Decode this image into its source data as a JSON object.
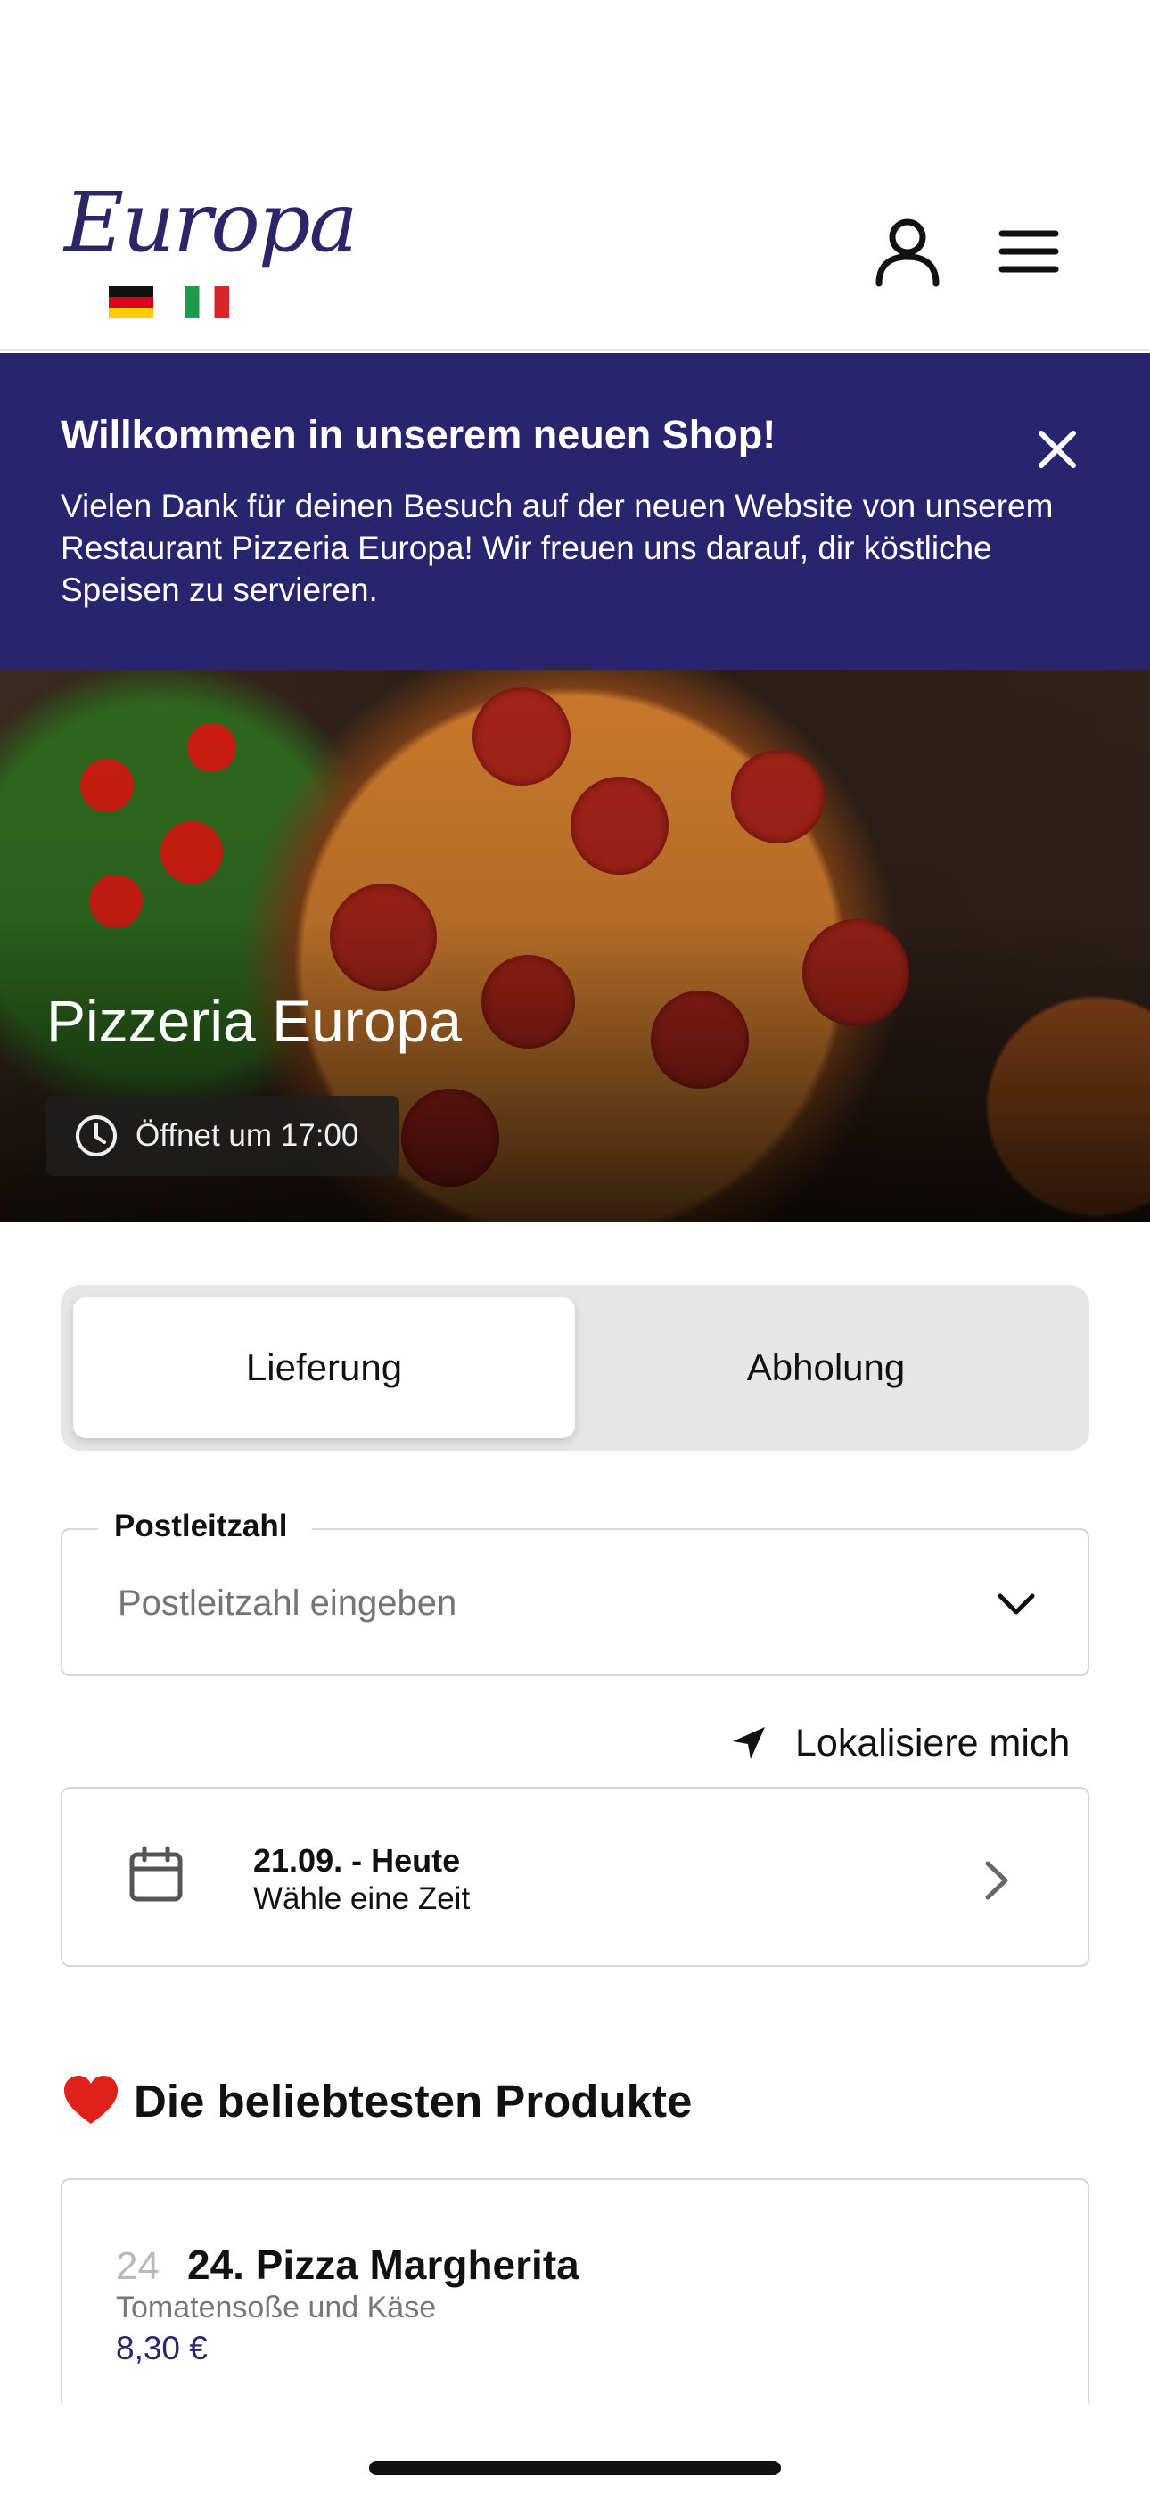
{
  "header": {
    "logo_text": "Europa",
    "languages": [
      {
        "code": "de",
        "icon": "german-flag-icon"
      },
      {
        "code": "it",
        "icon": "italian-flag-icon"
      }
    ],
    "user_icon": "user-icon",
    "menu_icon": "hamburger-menu-icon"
  },
  "banner": {
    "title": "Willkommen in unserem neuen Shop!",
    "text": "Vielen Dank für deinen Besuch auf der neuen Website von unserem Restaurant Pizzeria Europa! Wir freuen uns darauf, dir köstliche Speisen zu servieren.",
    "background": "#29246e",
    "close_icon": "close-icon"
  },
  "hero": {
    "restaurant_name": "Pizzeria Europa",
    "status": "Öffnet um 17:00",
    "status_icon": "clock-icon"
  },
  "order_mode": {
    "options": [
      "Lieferung",
      "Abholung"
    ],
    "selected": "Lieferung"
  },
  "postal_code": {
    "label": "Postleitzahl",
    "placeholder": "Postleitzahl eingeben",
    "value": ""
  },
  "locate": {
    "label": "Lokalisiere mich",
    "icon": "location-arrow-icon"
  },
  "schedule": {
    "date": "21.09. - Heute",
    "subtitle": "Wähle eine Zeit",
    "icon": "calendar-icon"
  },
  "popular": {
    "title": "Die beliebtesten Produkte",
    "icon": "heart-icon",
    "products": [
      {
        "number": "24",
        "name": "24. Pizza Margherita",
        "description": "Tomatensoße und Käse",
        "price": "8,30 €"
      }
    ]
  },
  "colors": {
    "accent": "#2b2667",
    "banner": "#29246e",
    "heart": "#e0211b"
  }
}
